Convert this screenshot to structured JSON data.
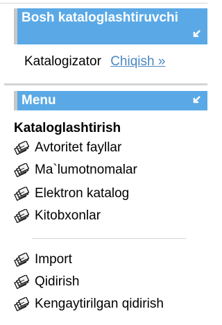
{
  "header1": {
    "title": "Bosh kataloglashtiruvchi"
  },
  "user": {
    "name": "Katalogizator",
    "logout": "Chiqish »"
  },
  "header2": {
    "title": "Menu"
  },
  "section": {
    "title": "Kataloglashtirish"
  },
  "menu": [
    {
      "label": "Avtoritet fayllar",
      "icon": "books-icon"
    },
    {
      "label": "Ma`lumotnomalar",
      "icon": "books-icon"
    },
    {
      "label": "Elektron katalog",
      "icon": "books-icon"
    },
    {
      "label": "Kitobxonlar",
      "icon": "books-icon"
    },
    {
      "label": "Import",
      "icon": "books-icon"
    },
    {
      "label": "Qidirish",
      "icon": "books-icon"
    },
    {
      "label": "Kengaytirilgan qidirish",
      "icon": "books-icon"
    }
  ],
  "colors": {
    "header_bg": "#5aa9e6",
    "link": "#4a87c4"
  }
}
